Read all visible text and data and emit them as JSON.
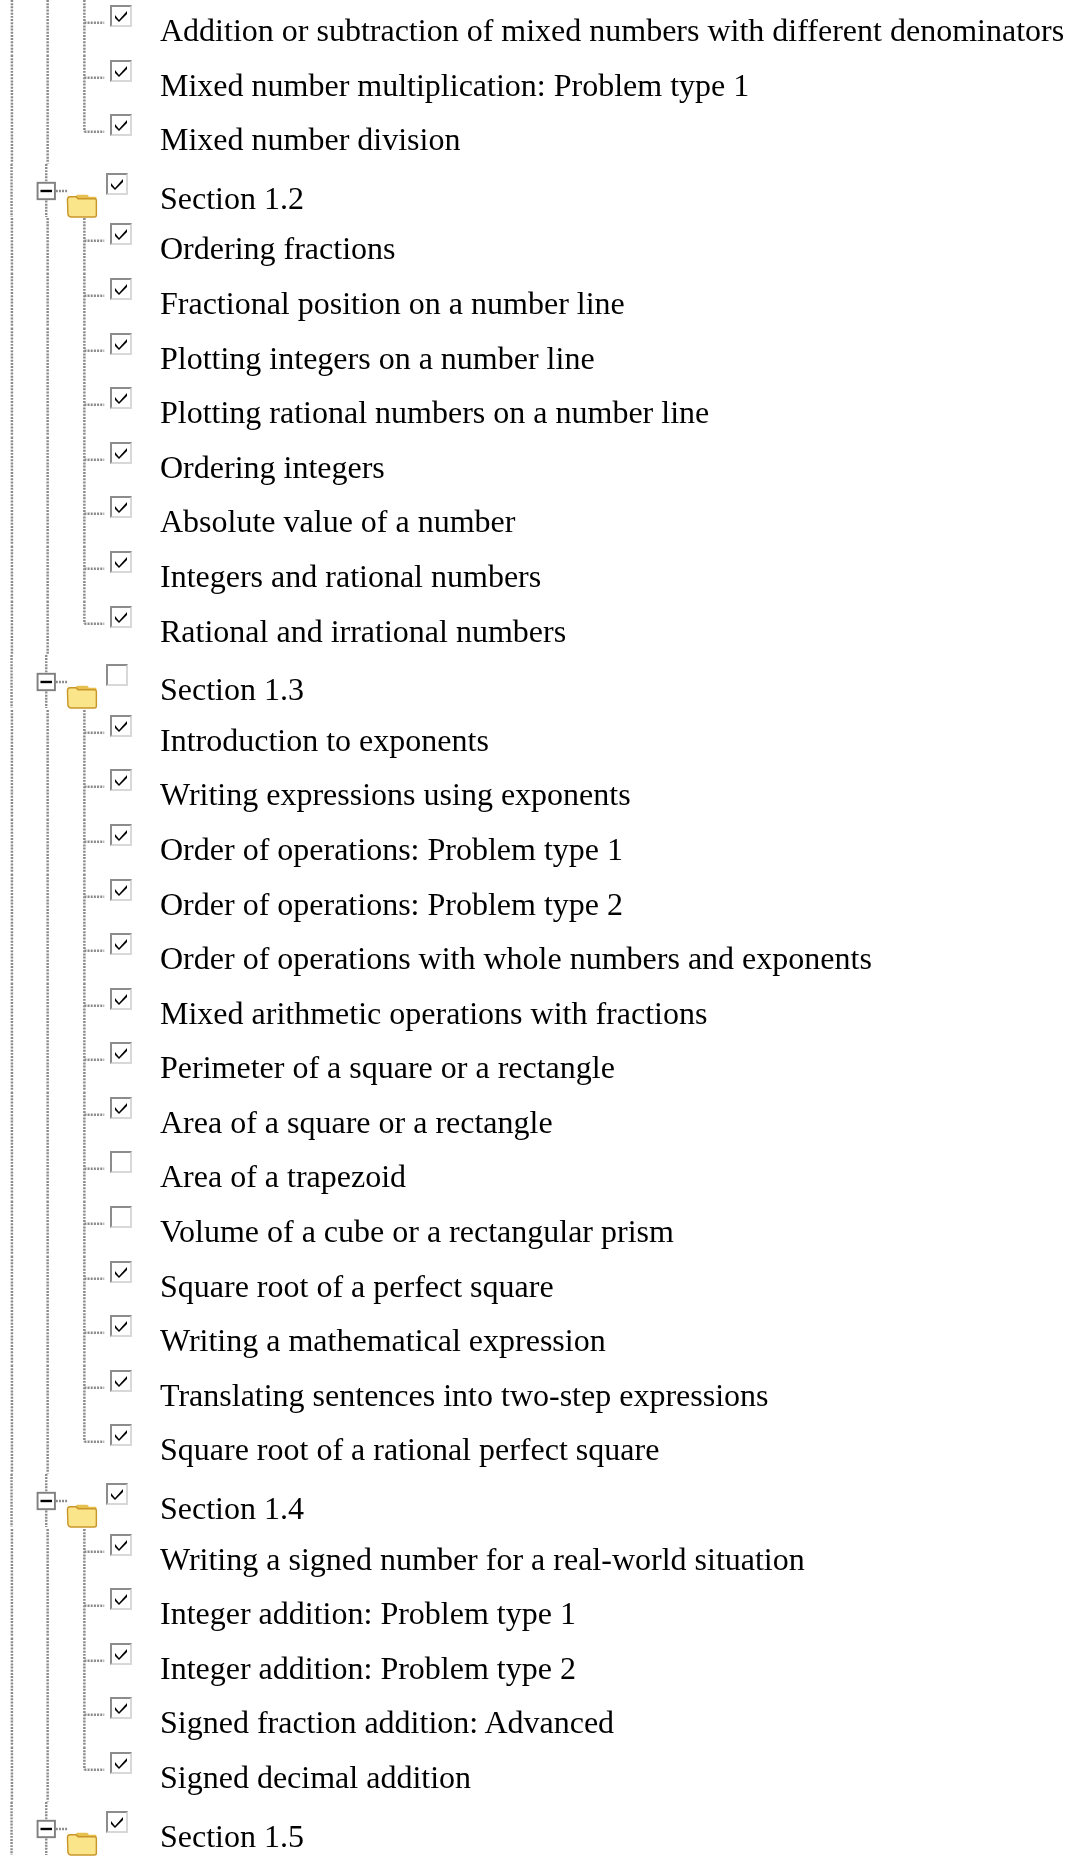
{
  "tree": [
    {
      "children": [
        {
          "label": "Addition or subtraction of mixed numbers with different denominators",
          "checked": true
        },
        {
          "label": "Mixed number multiplication: Problem type 1",
          "checked": true
        },
        {
          "label": "Mixed number division",
          "checked": true
        }
      ]
    },
    {
      "label": "Section 1.2",
      "expanded": true,
      "checked": true,
      "children": [
        {
          "label": "Ordering fractions",
          "checked": true
        },
        {
          "label": "Fractional position on a number line",
          "checked": true
        },
        {
          "label": "Plotting integers on a number line",
          "checked": true
        },
        {
          "label": "Plotting rational numbers on a number line",
          "checked": true
        },
        {
          "label": "Ordering integers",
          "checked": true
        },
        {
          "label": "Absolute value of a number",
          "checked": true
        },
        {
          "label": "Integers and rational numbers",
          "checked": true
        },
        {
          "label": "Rational and irrational numbers",
          "checked": true
        }
      ]
    },
    {
      "label": "Section 1.3",
      "expanded": true,
      "checked": false,
      "children": [
        {
          "label": "Introduction to exponents",
          "checked": true
        },
        {
          "label": "Writing expressions using exponents",
          "checked": true
        },
        {
          "label": "Order of operations: Problem type 1",
          "checked": true
        },
        {
          "label": "Order of operations: Problem type 2",
          "checked": true
        },
        {
          "label": "Order of operations with whole numbers and exponents",
          "checked": true
        },
        {
          "label": "Mixed arithmetic operations with fractions",
          "checked": true
        },
        {
          "label": "Perimeter of a square or a rectangle",
          "checked": true
        },
        {
          "label": "Area of a square or a rectangle",
          "checked": true
        },
        {
          "label": "Area of a trapezoid",
          "checked": false
        },
        {
          "label": "Volume of a cube or a rectangular prism",
          "checked": false
        },
        {
          "label": "Square root of a perfect square",
          "checked": true
        },
        {
          "label": "Writing a mathematical expression",
          "checked": true
        },
        {
          "label": "Translating sentences into two-step expressions",
          "checked": true
        },
        {
          "label": "Square root of a rational perfect square",
          "checked": true
        }
      ]
    },
    {
      "label": "Section 1.4",
      "expanded": true,
      "checked": true,
      "children": [
        {
          "label": "Writing a signed number for a real-world situation",
          "checked": true
        },
        {
          "label": "Integer addition: Problem type 1",
          "checked": true
        },
        {
          "label": "Integer addition: Problem type 2",
          "checked": true
        },
        {
          "label": "Signed fraction addition: Advanced",
          "checked": true
        },
        {
          "label": "Signed decimal addition",
          "checked": true
        }
      ]
    },
    {
      "label": "Section 1.5",
      "expanded": true,
      "checked": true
    }
  ]
}
